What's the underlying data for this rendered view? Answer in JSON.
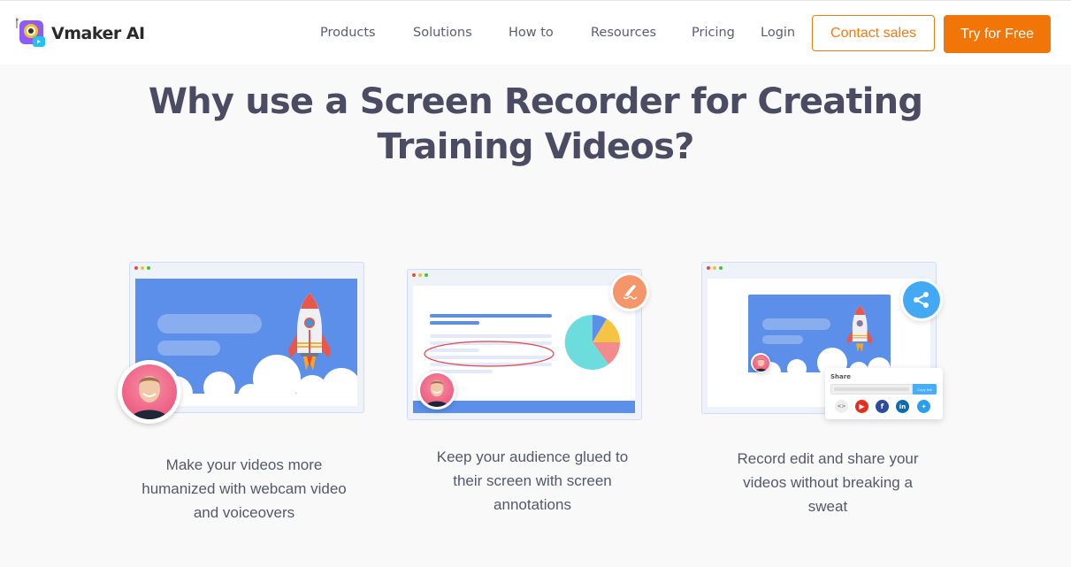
{
  "brand": {
    "name": "Vmaker AI",
    "icon": "vmaker-logo-icon"
  },
  "nav": {
    "items": [
      {
        "label": "Products"
      },
      {
        "label": "Solutions"
      },
      {
        "label": "How to"
      },
      {
        "label": "Resources"
      },
      {
        "label": "Pricing"
      },
      {
        "label": "Login"
      }
    ],
    "contact_label": "Contact sales",
    "try_label": "Try for Free"
  },
  "colors": {
    "accent": "#f27507",
    "heading": "#4b4b63",
    "background": "#f9f9f9",
    "illustration_blue": "#5b8fea",
    "share_blue": "#44a9f5",
    "annotate_orange": "#f4956a"
  },
  "section": {
    "title_line1": "Why use a Screen Recorder for Creating",
    "title_line2": "Training Videos?"
  },
  "features": [
    {
      "caption_lines": [
        "Make your videos more",
        "humanized with webcam video",
        "and voiceovers"
      ],
      "illustration": "webcam-recording-illustration"
    },
    {
      "caption_lines": [
        "Keep your audience glued to",
        "their screen with screen",
        "annotations"
      ],
      "illustration": "screen-annotation-illustration",
      "badge_icon": "pen-annotate-icon"
    },
    {
      "caption_lines": [
        "Record edit and share your",
        "videos without breaking a",
        "sweat"
      ],
      "illustration": "share-video-illustration",
      "badge_icon": "share-icon",
      "share_panel": {
        "title": "Share",
        "copy_label": "Copy link",
        "socials": [
          "embed",
          "youtube",
          "facebook",
          "linkedin",
          "twitter"
        ]
      }
    }
  ]
}
